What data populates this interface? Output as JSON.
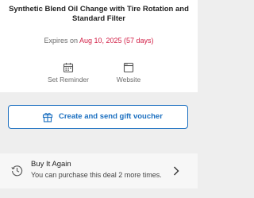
{
  "deal": {
    "title": "Synthetic Blend Oil Change with Tire Rotation and Standard Filter",
    "expiry_prefix": "Expires on ",
    "expiry_date": "Aug 10, 2025 (57 days)"
  },
  "actions": {
    "set_reminder": {
      "label": "Set Reminder",
      "icon": "calendar-icon"
    },
    "website": {
      "label": "Website",
      "icon": "website-icon"
    }
  },
  "gift": {
    "label": "Create and send gift voucher",
    "icon": "gift-icon"
  },
  "buy_again": {
    "title": "Buy It Again",
    "subtitle": "You can purchase this deal 2 more times.",
    "icon": "clock-icon"
  },
  "colors": {
    "accent_blue": "#1b6fc0",
    "expiry_red": "#d21f46",
    "muted_text": "#6b6b6b",
    "background": "#eeeeee"
  }
}
